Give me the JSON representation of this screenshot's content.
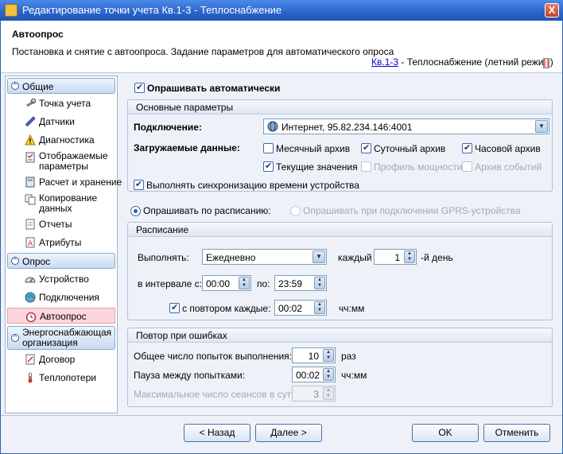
{
  "window": {
    "title": "Редактирование точки учета Кв.1-3 - Теплоснабжение",
    "close_glyph": "X"
  },
  "header": {
    "title": "Автоопрос",
    "description": "Постановка и снятие с автоопроса. Задание параметров для автоматического опроса",
    "crumb_link": "Кв.1-3",
    "crumb_text": " - Теплоснабжение (летний режим)"
  },
  "sidebar": {
    "sections": [
      {
        "label": "Общие",
        "items": [
          "Точка учета",
          "Датчики",
          "Диагностика",
          "Отображаемые параметры",
          "Расчет и хранение",
          "Копирование данных",
          "Отчеты",
          "Атрибуты"
        ]
      },
      {
        "label": "Опрос",
        "items": [
          "Устройство",
          "Подключения",
          "Автоопрос"
        ]
      },
      {
        "label": "Энергоснабжающая организация",
        "items": [
          "Договор",
          "Теплопотери"
        ]
      }
    ],
    "selected": "Автоопрос",
    "toggle_glyph": "^"
  },
  "main": {
    "auto_poll_label": "Опрашивать автоматически",
    "basic": {
      "header": "Основные параметры",
      "connection_label": "Подключение:",
      "connection_value": "Интернет, 95.82.234.146:4001",
      "data_label": "Загружаемые данные:",
      "options": [
        {
          "label": "Месячный архив",
          "checked": false,
          "enabled": true
        },
        {
          "label": "Суточный архив",
          "checked": true,
          "enabled": true
        },
        {
          "label": "Часовой архив",
          "checked": true,
          "enabled": true
        },
        {
          "label": "Текущие значения",
          "checked": true,
          "enabled": true
        },
        {
          "label": "Профиль мощности",
          "checked": false,
          "enabled": false
        },
        {
          "label": "Архив событий",
          "checked": false,
          "enabled": false
        }
      ],
      "sync_label": "Выполнять синхронизацию времени устройства"
    },
    "mode": {
      "schedule_label": "Опрашивать по расписанию:",
      "gprs_label": "Опрашивать при подключении GPRS-устройства"
    },
    "schedule": {
      "header": "Расписание",
      "run_label": "Выполнять:",
      "run_value": "Ежедневно",
      "every_label": "каждый",
      "every_value": "1",
      "day_suffix": "-й день",
      "interval_label": "в интервале с:",
      "from": "00:00",
      "to_label": "по:",
      "to": "23:59",
      "repeat_label": "с повтором каждые:",
      "repeat_value": "00:02",
      "repeat_unit": "чч:мм"
    },
    "retry": {
      "header": "Повтор при ошибках",
      "attempts_label": "Общее число попыток выполнения:",
      "attempts_value": "10",
      "attempts_unit": "раз",
      "pause_label": "Пауза между попытками:",
      "pause_value": "00:02",
      "pause_unit": "чч:мм",
      "max_label": "Максимальное число сеансов в сутки:",
      "max_value": "3"
    }
  },
  "footer": {
    "back": "< Назад",
    "next": "Далее >",
    "ok": "OK",
    "cancel": "Отменить"
  },
  "spin_glyphs": {
    "up": "▲",
    "down": "▼"
  },
  "dropdown_glyph": "▼"
}
